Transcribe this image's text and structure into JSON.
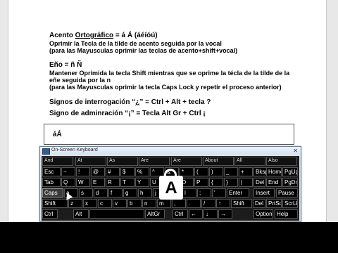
{
  "document": {
    "line1_a": "Acento ",
    "line1_b": "Ortográfico",
    "line1_c": " =  á Á (áéíóú)",
    "line2": "Oprimir la Tecla de la tilde de acento seguida por la vocal",
    "line3": "(para las Mayusculas oprimir las teclas de acento+shift+vocal)",
    "line4": "Eño = ñ Ñ",
    "line5": "Mantener Oprimida la tecla Shift mientras que se oprime la técla de la tilde de la",
    "line6": "eñe seguida por la n",
    "line7": "(para las Mayusculas oprimir la tecla Caps Lock y repetir el proceso anterior)",
    "line8_a": "Signos de interrogación  “",
    "line8_b": "¿",
    "line8_c": "” = Ctrl + Alt + tecla  ?",
    "line9_a": "Signo de adminración “",
    "line9_b": "¡",
    "line9_c": "” = Tecla Alt Gr + Ctrl  ¡",
    "typed": "áÁ"
  },
  "osk": {
    "title": "On-Screen Keyboard",
    "close": "✕",
    "big_key": "A",
    "rows": [
      [
        "And",
        "At",
        "As",
        "Are",
        "Are",
        "About",
        "All",
        "Also"
      ],
      [
        "Esc",
        "~",
        "!",
        "@",
        "#",
        "$",
        "%",
        "^",
        "&",
        "*",
        "(",
        ")",
        "_",
        "+",
        "Bksp",
        "Home",
        "PgUp"
      ],
      [
        "Tab",
        "Q",
        "W",
        "E",
        "R",
        "T",
        "Y",
        "U",
        "I",
        "O",
        "P",
        "{",
        "}",
        "|",
        "Del",
        "End",
        "PgDn"
      ],
      [
        "Caps",
        "a",
        "s",
        "d",
        "f",
        "g",
        "h",
        "j",
        "k",
        "l",
        ";",
        "'",
        "Enter",
        "Insert",
        "Pause"
      ],
      [
        "Shift",
        "z",
        "x",
        "c",
        "v",
        "b",
        "n",
        "m",
        ",",
        ".",
        "/",
        "↑",
        "Shift",
        "Del",
        "PrtScn",
        "ScrLk"
      ],
      [
        "Ctrl",
        "Alt",
        "",
        "AltGr",
        "Ctrl",
        "←",
        "↓",
        "→",
        "Options",
        "Help"
      ]
    ]
  },
  "colors": {
    "key_bg": "#000000",
    "key_border": "#555555",
    "osk_frame": "#d8e4f0"
  }
}
